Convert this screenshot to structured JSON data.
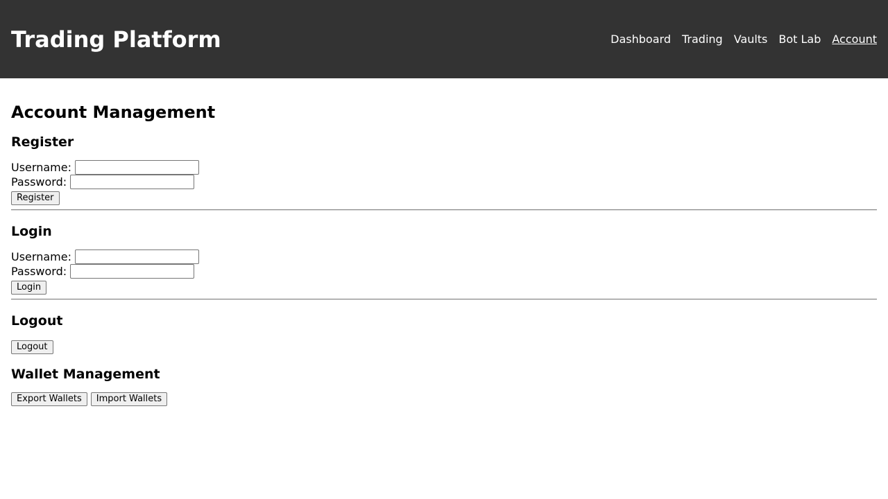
{
  "header": {
    "title": "Trading Platform",
    "nav": [
      {
        "label": "Dashboard",
        "active": false
      },
      {
        "label": "Trading",
        "active": false
      },
      {
        "label": "Vaults",
        "active": false
      },
      {
        "label": "Bot Lab",
        "active": false
      },
      {
        "label": "Account",
        "active": true
      }
    ]
  },
  "colors": {
    "header_bg": "#333333",
    "header_text": "#ffffff"
  },
  "main": {
    "title": "Account Management",
    "register": {
      "heading": "Register",
      "username_label": "Username:",
      "username_value": "",
      "password_label": "Password:",
      "password_value": "",
      "button": "Register"
    },
    "login": {
      "heading": "Login",
      "username_label": "Username:",
      "username_value": "",
      "password_label": "Password:",
      "password_value": "",
      "button": "Login"
    },
    "logout": {
      "heading": "Logout",
      "button": "Logout"
    },
    "wallet": {
      "heading": "Wallet Management",
      "export_button": "Export Wallets",
      "import_button": "Import Wallets"
    }
  }
}
